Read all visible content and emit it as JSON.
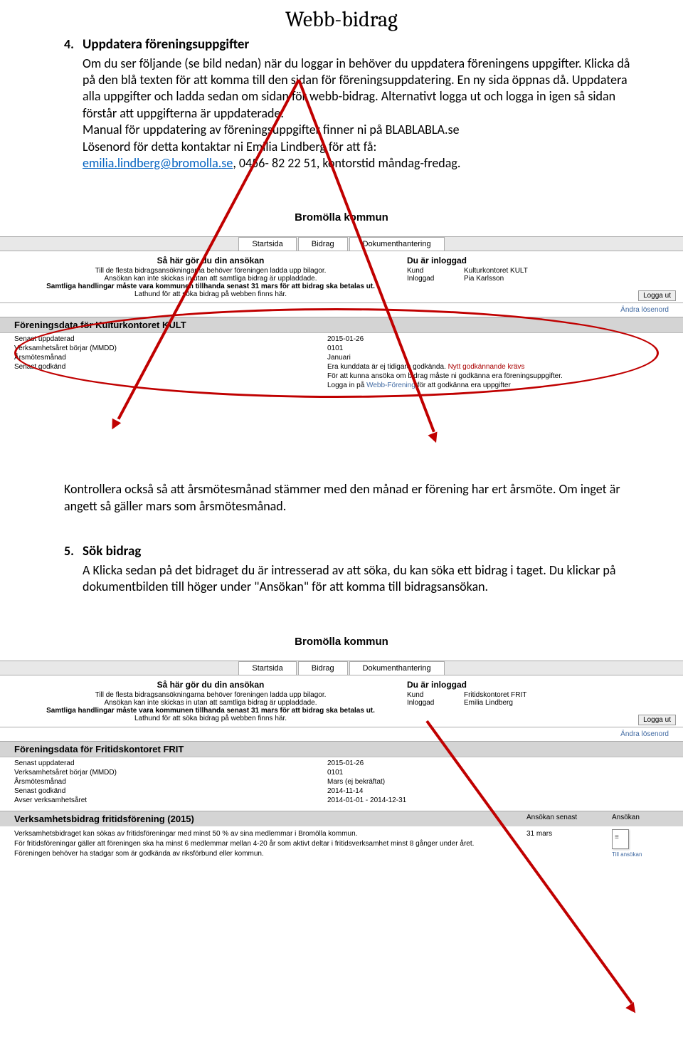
{
  "title": "Webb-bidrag",
  "section4": {
    "num": "4.",
    "heading": "Uppdatera föreningsuppgifter",
    "p1": "Om du ser följande (se bild nedan) när du loggar in behöver du uppdatera föreningens uppgifter. Klicka då på den blå texten för att komma till den sidan för föreningsuppdatering. En ny sida öppnas då. Uppdatera alla uppgifter och ladda sedan om sidan för webb-bidrag. Alternativt logga ut och logga in igen så sidan förstår att uppgifterna är uppdaterade.",
    "p2a": "Manual för uppdatering av föreningsuppgifter finner ni på BLABLABLA.se",
    "p2b": "Lösenord för detta kontaktar ni Emilia Lindberg för att få:",
    "email": "emilia.lindberg@bromolla.se",
    "p2c": ", 0456- 82 22 51, kontorstid måndag-fredag."
  },
  "ss1": {
    "header": "Bromölla kommun",
    "tabs": [
      "Startsida",
      "Bidrag",
      "Dokumenthantering"
    ],
    "info_title": "Så här gör du din ansökan",
    "info_l1": "Till de flesta bidragsansökningarna behöver föreningen ladda upp bilagor.",
    "info_l2": "Ansökan kan inte skickas in utan att samtliga bidrag är uppladdade.",
    "info_l3": "Samtliga handlingar måste vara kommunen tillhanda senast 31 mars för att bidrag ska betalas ut.",
    "info_l4": "Lathund för att söka bidrag på webben finns här.",
    "login_title": "Du är inloggad",
    "login_k1": "Kund",
    "login_v1": "Kulturkontoret KULT",
    "login_k2": "Inloggad",
    "login_v2": "Pia Karlsson",
    "logout": "Logga ut",
    "andra": "Ändra lösenord",
    "section_bar": "Föreningsdata för Kulturkontoret KULT",
    "rows": [
      {
        "label": "Senast uppdaterad",
        "value": "2015-01-26"
      },
      {
        "label": "Verksamhetsåret börjar (MMDD)",
        "value": "0101"
      },
      {
        "label": "Årsmötesmånad",
        "value": "Januari"
      },
      {
        "label": "Senast godkänd",
        "value": "Era kunddata är ej tidigare godkända. ",
        "red": "Nytt godkännande krävs"
      }
    ],
    "extra1": "För att kunna ansöka om bidrag måste ni godkänna era föreningsuppgifter.",
    "extra2a": "Logga in på ",
    "extra2link": "Webb-Förening",
    "extra2b": " för att godkänna era uppgifter"
  },
  "mid_p": "Kontrollera också så att årsmötesmånad stämmer med den månad er förening har ert årsmöte. Om inget är angett så gäller mars som årsmötesmånad.",
  "section5": {
    "num": "5.",
    "heading": "Sök bidrag",
    "p1": "A Klicka sedan på det bidraget du är intresserad av att söka, du kan söka ett bidrag i taget. Du klickar på dokumentbilden till höger under \"Ansökan\" för att komma till bidragsansökan."
  },
  "ss2": {
    "header": "Bromölla kommun",
    "tabs": [
      "Startsida",
      "Bidrag",
      "Dokumenthantering"
    ],
    "info_title": "Så här gör du din ansökan",
    "info_l1": "Till de flesta bidragsansökningarna behöver föreningen ladda upp bilagor.",
    "info_l2": "Ansökan kan inte skickas in utan att samtliga bidrag är uppladdade.",
    "info_l3": "Samtliga handlingar måste vara kommunen tillhanda senast 31 mars för att bidrag ska betalas ut.",
    "info_l4": "Lathund för att söka bidrag på webben finns här.",
    "login_title": "Du är inloggad",
    "login_k1": "Kund",
    "login_v1": "Fritidskontoret FRIT",
    "login_k2": "Inloggad",
    "login_v2": "Emilia Lindberg",
    "logout": "Logga ut",
    "andra": "Ändra lösenord",
    "section_bar": "Föreningsdata för Fritidskontoret FRIT",
    "rows": [
      {
        "label": "Senast uppdaterad",
        "value": "2015-01-26"
      },
      {
        "label": "Verksamhetsåret börjar (MMDD)",
        "value": "0101"
      },
      {
        "label": "Årsmötesmånad",
        "value": "Mars (ej bekräftat)"
      },
      {
        "label": "Senast godkänd",
        "value": "2014-11-14"
      },
      {
        "label": "Avser verksamhetsåret",
        "value": "2014-01-01 - 2014-12-31"
      }
    ],
    "grant_title": "Verksamhetsbidrag fritidsförening (2015)",
    "grant_h2": "Ansökan senast",
    "grant_h3": "Ansökan",
    "grant_body1": "Verksamhetsbidraget kan sökas av fritidsföreningar med minst 50 % av sina medlemmar i Bromölla kommun.",
    "grant_body2": "För fritidsföreningar gäller att föreningen ska ha minst 6 medlemmar mellan 4-20 år som aktivt deltar i fritidsverksamhet minst 8 gånger under året.",
    "grant_body3": "Föreningen behöver ha stadgar som är godkända av riksförbund eller kommun.",
    "grant_deadline": "31 mars",
    "till": "Till ansökan"
  }
}
